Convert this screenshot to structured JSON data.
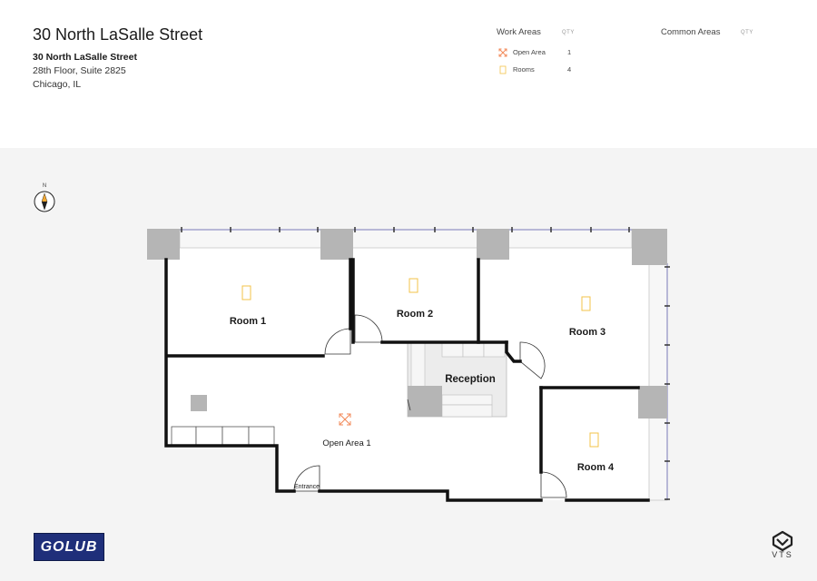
{
  "header": {
    "title": "30 North LaSalle Street",
    "building": "30 North LaSalle Street",
    "suite": "28th Floor, Suite 2825",
    "city": "Chicago, IL"
  },
  "legend": {
    "work_areas": {
      "heading": "Work Areas",
      "qty_label": "QTY",
      "items": [
        {
          "label": "Open Area",
          "qty": "1",
          "icon": "open-area-icon",
          "color": "#f28a5a"
        },
        {
          "label": "Rooms",
          "qty": "4",
          "icon": "room-icon",
          "color": "#f3c34a"
        }
      ]
    },
    "common_areas": {
      "heading": "Common Areas",
      "qty_label": "QTY"
    }
  },
  "compass": {
    "label": "N"
  },
  "plan": {
    "rooms": [
      {
        "label": "Room 1"
      },
      {
        "label": "Room 2"
      },
      {
        "label": "Room 3"
      },
      {
        "label": "Room 4"
      },
      {
        "label": "Reception"
      },
      {
        "label": "Open Area 1"
      },
      {
        "label": "Entrance"
      }
    ]
  },
  "logos": {
    "golub": "GOLUB",
    "vts": "VTS"
  },
  "colors": {
    "wall": "#111111",
    "column": "#b5b5b5",
    "room_icon": "#f3c34a",
    "open_icon": "#f28a5a",
    "golub_bg": "#1f2f7a"
  }
}
